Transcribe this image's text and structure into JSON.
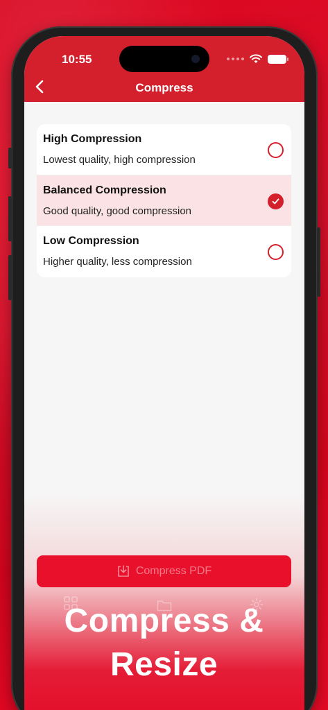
{
  "status_bar": {
    "time": "10:55"
  },
  "header": {
    "title": "Compress"
  },
  "options": [
    {
      "title": "High Compression",
      "description": "Lowest quality, high compression",
      "selected": false
    },
    {
      "title": "Balanced Compression",
      "description": "Good quality, good compression",
      "selected": true
    },
    {
      "title": "Low Compression",
      "description": "Higher quality, less compression",
      "selected": false
    }
  ],
  "action": {
    "label": "Compress PDF"
  },
  "promo": {
    "line1": "Compress &",
    "line2": "Resize"
  },
  "colors": {
    "accent": "#d4202c",
    "background": "#e30a26",
    "selected_row": "#fbe3e5"
  }
}
